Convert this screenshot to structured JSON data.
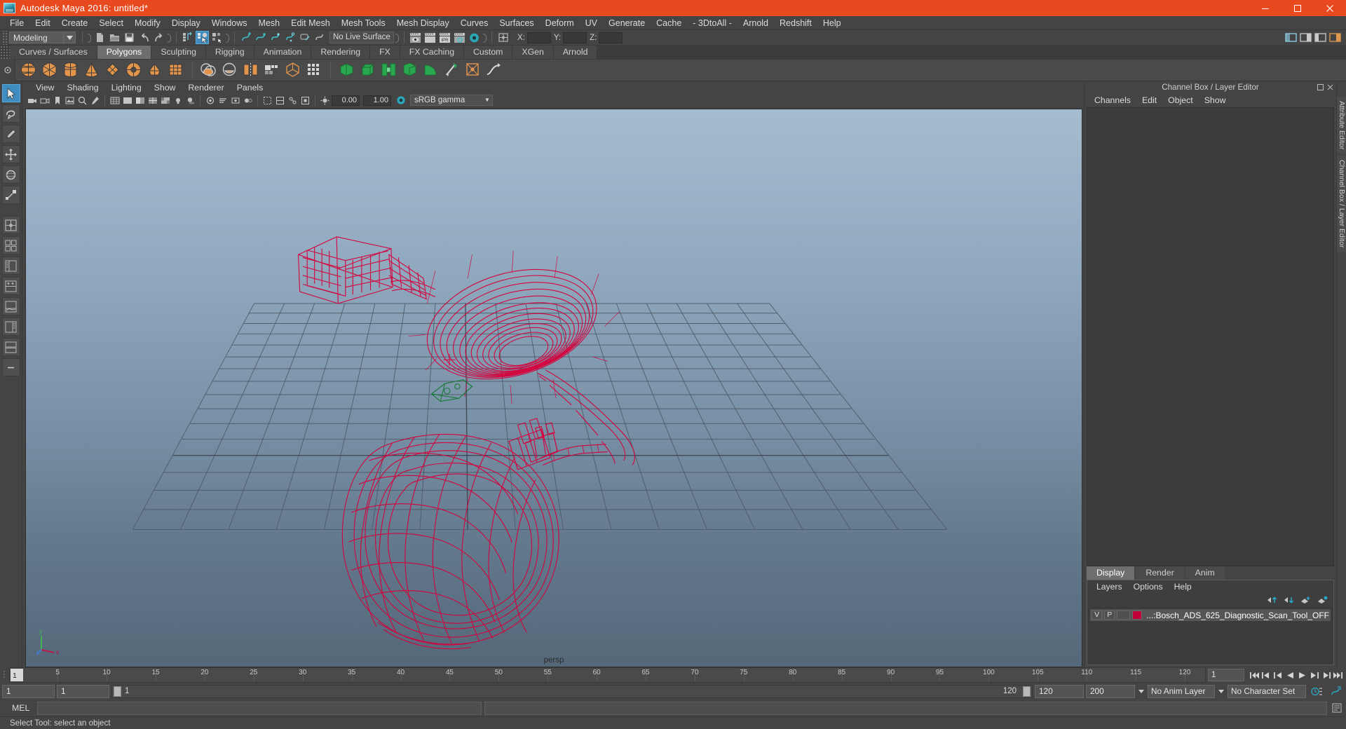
{
  "window": {
    "title": "Autodesk Maya 2016: untitled*",
    "logo_icon": "maya-logo-icon",
    "minimize_icon": "minimize-icon",
    "maximize_icon": "maximize-icon",
    "close_icon": "close-icon",
    "accent_color": "#e8491e"
  },
  "menubar": {
    "items": [
      "File",
      "Edit",
      "Create",
      "Select",
      "Modify",
      "Display",
      "Windows",
      "Mesh",
      "Edit Mesh",
      "Mesh Tools",
      "Mesh Display",
      "Curves",
      "Surfaces",
      "Deform",
      "UV",
      "Generate",
      "Cache",
      "- 3DtoAll -",
      "Arnold",
      "Redshift",
      "Help"
    ]
  },
  "toolbar": {
    "menuset": "Modeling",
    "menuset_arrow": "▼",
    "live_surface": "No Live Surface",
    "x_label": "X:",
    "y_label": "Y:",
    "z_label": "Z:",
    "x_value": "",
    "y_value": "",
    "z_value": ""
  },
  "shelf": {
    "tabs": [
      {
        "label": "Curves / Surfaces",
        "active": false
      },
      {
        "label": "Polygons",
        "active": true
      },
      {
        "label": "Sculpting",
        "active": false
      },
      {
        "label": "Rigging",
        "active": false
      },
      {
        "label": "Animation",
        "active": false
      },
      {
        "label": "Rendering",
        "active": false
      },
      {
        "label": "FX",
        "active": false
      },
      {
        "label": "FX Caching",
        "active": false
      },
      {
        "label": "Custom",
        "active": false
      },
      {
        "label": "XGen",
        "active": false
      },
      {
        "label": "Arnold",
        "active": false
      }
    ],
    "primitive_color": "#e2944a",
    "tool_color": "#3fb8ae"
  },
  "viewport": {
    "menus": [
      "View",
      "Shading",
      "Lighting",
      "Show",
      "Renderer",
      "Panels"
    ],
    "exposure_value": "0.00",
    "gamma_value": "1.00",
    "color_profile": "sRGB gamma",
    "camera_label": "persp",
    "axis_labels": {
      "y": "y",
      "x": "x",
      "z": "z"
    },
    "bg_top": "#a5bcd0",
    "bg_bottom": "#56697b",
    "wireframe_color": "#d6003c",
    "model_name": "Bosch ADS 625 Diagnostic Scan Tool"
  },
  "channelbox": {
    "dock_title": "Channel Box / Layer Editor",
    "menus": [
      "Channels",
      "Edit",
      "Object",
      "Show"
    ]
  },
  "layer_editor": {
    "tabs": [
      {
        "label": "Display",
        "active": true
      },
      {
        "label": "Render",
        "active": false
      },
      {
        "label": "Anim",
        "active": false
      }
    ],
    "menus": [
      "Layers",
      "Options",
      "Help"
    ],
    "icons": [
      "move-layer-up-icon",
      "move-layer-down-icon",
      "new-layer-icon",
      "new-layer-from-selected-icon"
    ],
    "layers": [
      {
        "visibility": "V",
        "playback": "P",
        "type": "",
        "color": "#c2003a",
        "name": "...:Bosch_ADS_625_Diagnostic_Scan_Tool_OFF"
      }
    ]
  },
  "vertical_tabs": [
    "Attribute Editor",
    "Channel Box / Layer Editor"
  ],
  "timeslider": {
    "current_frame": "1",
    "current_frame_field": "1",
    "ticks": [
      "5",
      "10",
      "15",
      "20",
      "25",
      "30",
      "35",
      "40",
      "45",
      "50",
      "55",
      "60",
      "65",
      "70",
      "75",
      "80",
      "85",
      "90",
      "95",
      "100",
      "105",
      "110",
      "115",
      "120"
    ],
    "playback_icons": [
      "go-to-start-icon",
      "step-back-frame-icon",
      "step-back-key-icon",
      "play-backwards-icon",
      "play-forwards-icon",
      "step-forward-key-icon",
      "step-forward-frame-icon",
      "go-to-end-icon"
    ]
  },
  "rangeslider": {
    "start_field": "1",
    "range_start_field": "1",
    "bar_start_label": "1",
    "bar_end_label": "120",
    "range_end_field": "120",
    "end_field": "200",
    "anim_layer": "No Anim Layer",
    "character_set": "No Character Set",
    "anim_pref_icon": "animation-preferences-icon",
    "select_icon": "character-set-icon"
  },
  "mel": {
    "label": "MEL",
    "input_value": "",
    "output_value": ""
  },
  "statusbar": {
    "text": "Select Tool: select an object"
  }
}
